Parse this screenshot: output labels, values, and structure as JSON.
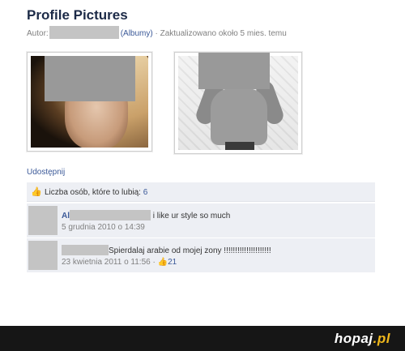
{
  "album": {
    "title": "Profile Pictures",
    "author_label": "Autor:",
    "albums_link": "(Albumy)",
    "updated": "· Zaktualizowano około 5 mies. temu"
  },
  "actions": {
    "share_label": "Udostępnij"
  },
  "likes": {
    "label": "Liczba osób, które to lubią:",
    "count": "6"
  },
  "comments": [
    {
      "author": "Al",
      "text": "i like ur style so much",
      "time": "5 grudnia 2010 o 14:39"
    },
    {
      "author": "",
      "text": "Spierdalaj arabie od mojej zony !!!!!!!!!!!!!!!!!!!!!",
      "time": "23 kwietnia 2011 o 11:56",
      "separator": "·",
      "likes": "21"
    }
  ],
  "watermark": {
    "name": "hopaj",
    "tld": ".pl"
  },
  "icons": {
    "like": "thumbs-up-icon"
  },
  "colors": {
    "link": "#3b5998",
    "panel": "#edeff4",
    "footer": "#161616",
    "accent": "#f0b81c"
  }
}
